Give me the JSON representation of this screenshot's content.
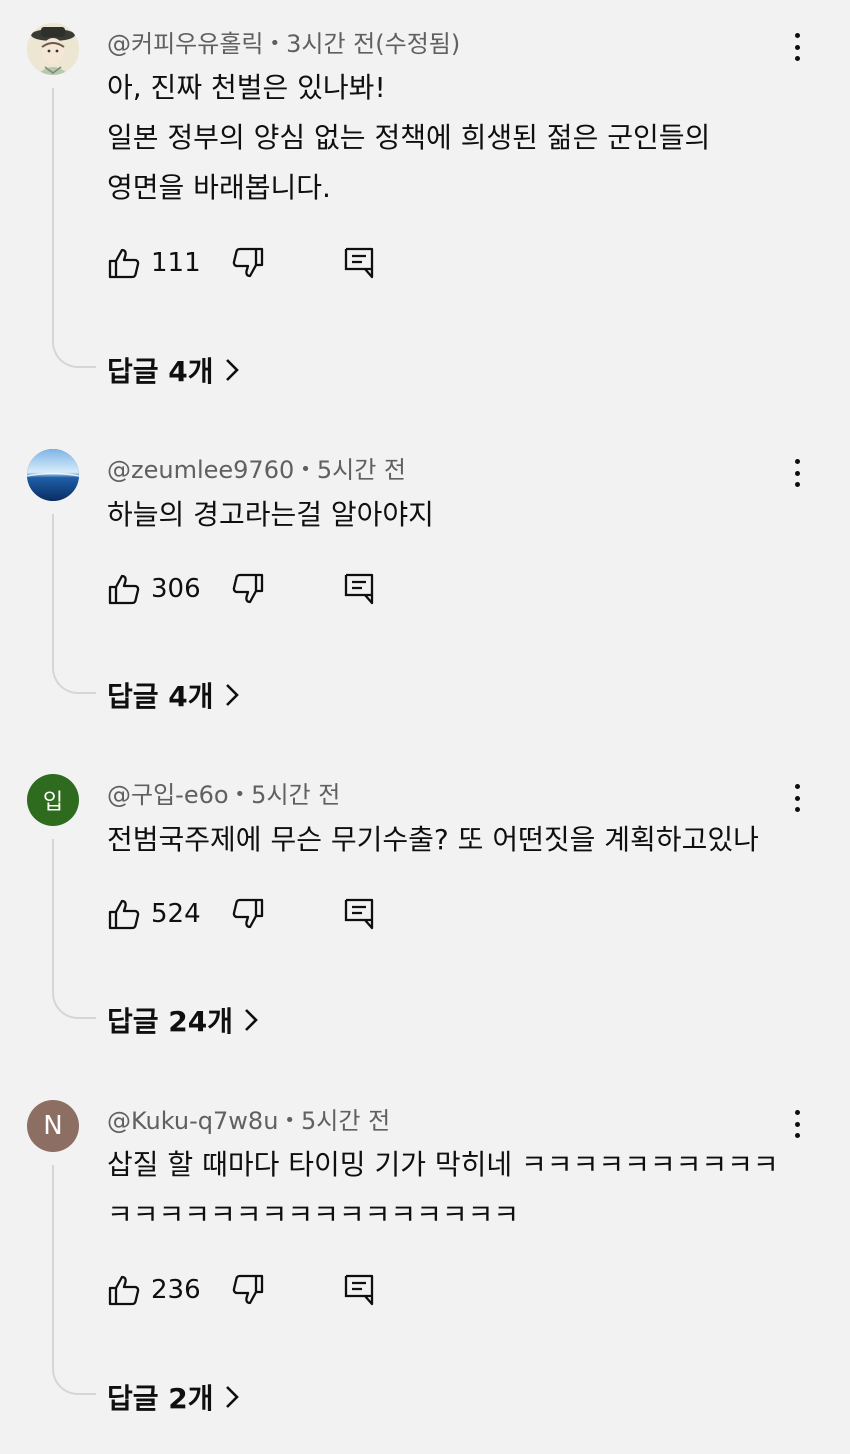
{
  "comments": [
    {
      "handle": "@커피우유홀릭",
      "time": "3시간 전(수정됨)",
      "lines": [
        "아, 진짜 천벌은 있나봐!",
        "일본 정부의 양심 없는 정책에 희생된 젊은 군인들의",
        "영면을 바래봅니다."
      ],
      "likes": "111",
      "replies": "답글 4개",
      "avatar": {
        "type": "illustration",
        "letter": ""
      }
    },
    {
      "handle": "@zeumlee9760",
      "time": "5시간 전",
      "lines": [
        "하늘의 경고라는걸 알아야지"
      ],
      "likes": "306",
      "replies": "답글 4개",
      "avatar": {
        "type": "photo-sea",
        "letter": ""
      }
    },
    {
      "handle": "@구입-e6o",
      "time": "5시간 전",
      "lines": [
        "전범국주제에 무슨 무기수출? 또 어떤짓을 계획하고있나"
      ],
      "likes": "524",
      "replies": "답글 24개",
      "avatar": {
        "type": "letter",
        "letter": "입",
        "color": "#2e6b1f"
      }
    },
    {
      "handle": "@Kuku-q7w8u",
      "time": "5시간 전",
      "lines": [
        "삽질 할 때마다 타이밍 기가 막히네 ㅋㅋㅋㅋㅋㅋㅋㅋㅋㅋ",
        "ㅋㅋㅋㅋㅋㅋㅋㅋㅋㅋㅋㅋㅋㅋㅋㅋ"
      ],
      "likes": "236",
      "replies": "답글 2개",
      "avatar": {
        "type": "letter",
        "letter": "N",
        "color": "#8d6e63"
      }
    }
  ],
  "icons": {
    "like": "thumbs-up-icon",
    "dislike": "thumbs-down-icon",
    "reply": "comment-icon",
    "more": "more-vert-icon",
    "expand": "chevron-right-icon"
  }
}
